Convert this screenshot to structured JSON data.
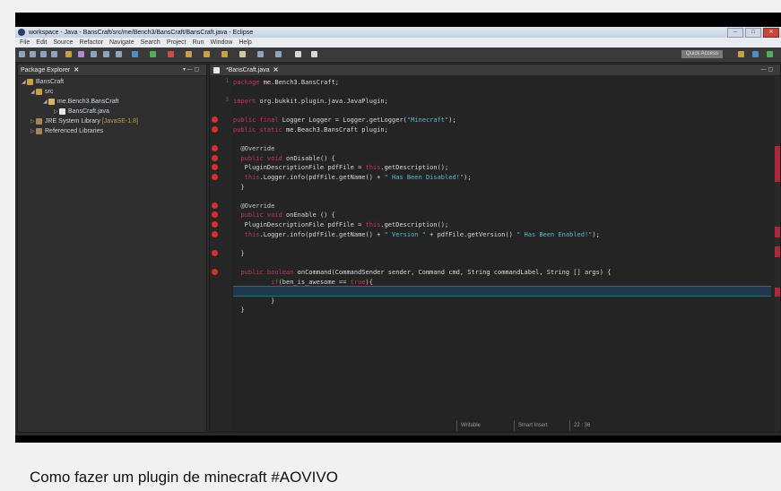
{
  "window": {
    "title": "workspace - Java - BansCraft/src/me/Bench3/BansCraft/BansCraft.java - Eclipse"
  },
  "menu": [
    "File",
    "Edit",
    "Source",
    "Refactor",
    "Navigate",
    "Search",
    "Project",
    "Run",
    "Window",
    "Help"
  ],
  "toolbar": {
    "quick_access": "Quick Access"
  },
  "package_explorer": {
    "title": "Package Explorer",
    "project": "BansCraft",
    "src": "src",
    "package": "me.Bench3.BansCraft",
    "file": "BansCraft.java",
    "jre": "JRE System Library",
    "jre_version": "[JavaSE-1.8]",
    "ref_libs": "Referenced Libraries"
  },
  "editor": {
    "tab": "*BansCraft.java",
    "lines": [
      {
        "n": "1",
        "segs": [
          {
            "t": "package ",
            "c": "kw"
          },
          {
            "t": "me.Bench3.BansCraft;",
            "c": ""
          }
        ]
      },
      {
        "n": "",
        "segs": []
      },
      {
        "n": "3",
        "segs": [
          {
            "t": "import ",
            "c": "kw"
          },
          {
            "t": "org.bukkit.plugin.java.JavaPlugin;",
            "c": ""
          }
        ]
      },
      {
        "n": "",
        "segs": []
      },
      {
        "n": "",
        "segs": [
          {
            "t": "public final ",
            "c": "kw"
          },
          {
            "t": "Logger Logger = Logger.getLogger(",
            "c": ""
          },
          {
            "t": "\"Minecraft\"",
            "c": "str"
          },
          {
            "t": ");",
            "c": ""
          }
        ]
      },
      {
        "n": "",
        "segs": [
          {
            "t": "public static ",
            "c": "kw"
          },
          {
            "t": "me.Beach3.BansCraft plugin;",
            "c": ""
          }
        ]
      },
      {
        "n": "",
        "segs": []
      },
      {
        "n": "",
        "segs": [
          {
            "t": "  @Override",
            "c": "ann"
          }
        ]
      },
      {
        "n": "",
        "segs": [
          {
            "t": "  public void ",
            "c": "kw"
          },
          {
            "t": "onDisable() {",
            "c": ""
          }
        ]
      },
      {
        "n": "",
        "segs": [
          {
            "t": "   PluginDescriptionFile pdfFile = ",
            "c": ""
          },
          {
            "t": "this",
            "c": "kw"
          },
          {
            "t": ".getDescription();",
            "c": ""
          }
        ]
      },
      {
        "n": "",
        "segs": [
          {
            "t": "   ",
            "c": ""
          },
          {
            "t": "this",
            "c": "kw"
          },
          {
            "t": ".Logger.info(pdfFile.getName() + ",
            "c": ""
          },
          {
            "t": "\" Has Been Disabled!\"",
            "c": "str"
          },
          {
            "t": ");",
            "c": ""
          }
        ]
      },
      {
        "n": "",
        "segs": [
          {
            "t": "  }",
            "c": ""
          }
        ]
      },
      {
        "n": "",
        "segs": []
      },
      {
        "n": "",
        "segs": [
          {
            "t": "  @Override",
            "c": "ann"
          }
        ]
      },
      {
        "n": "",
        "segs": [
          {
            "t": "  public void ",
            "c": "kw"
          },
          {
            "t": "onEnable () {",
            "c": ""
          }
        ]
      },
      {
        "n": "",
        "segs": [
          {
            "t": "   PluginDescriptionFile pdfFile = ",
            "c": ""
          },
          {
            "t": "this",
            "c": "kw"
          },
          {
            "t": ".getDescription();",
            "c": ""
          }
        ]
      },
      {
        "n": "",
        "segs": [
          {
            "t": "   ",
            "c": ""
          },
          {
            "t": "this",
            "c": "kw"
          },
          {
            "t": ".Logger.info(pdfFile.getName() + ",
            "c": ""
          },
          {
            "t": "\" Version \"",
            "c": "str"
          },
          {
            "t": " + pdfFile.getVersion() ",
            "c": ""
          },
          {
            "t": "\" Has Been Enabled!\"",
            "c": "str"
          },
          {
            "t": ");",
            "c": ""
          }
        ]
      },
      {
        "n": "",
        "segs": []
      },
      {
        "n": "",
        "segs": [
          {
            "t": "  }",
            "c": ""
          }
        ]
      },
      {
        "n": "",
        "segs": []
      },
      {
        "n": "",
        "segs": [
          {
            "t": "  public boolean ",
            "c": "kw"
          },
          {
            "t": "onCommand(CommandSender sender, Command cmd, String commandLabel, String [] args) {",
            "c": ""
          }
        ]
      },
      {
        "n": "",
        "segs": [
          {
            "t": "          ",
            "c": ""
          },
          {
            "t": "if",
            "c": "kw"
          },
          {
            "t": "(ben_is_awesome == ",
            "c": ""
          },
          {
            "t": "true",
            "c": "kw"
          },
          {
            "t": "){",
            "c": ""
          }
        ]
      },
      {
        "n": "",
        "segs": []
      },
      {
        "n": "",
        "segs": [
          {
            "t": "          }",
            "c": ""
          }
        ]
      },
      {
        "n": "",
        "segs": [
          {
            "t": "  }",
            "c": ""
          }
        ]
      }
    ]
  },
  "statusbar": {
    "writable": "Writable",
    "insert": "Smart Insert",
    "position": "22 : 36"
  },
  "video": {
    "title": "Como fazer um plugin de minecraft #AOVIVO"
  },
  "colors": {
    "keyword": "#cc3363",
    "string": "#57b9d6",
    "error_marker": "#d42f2f"
  }
}
